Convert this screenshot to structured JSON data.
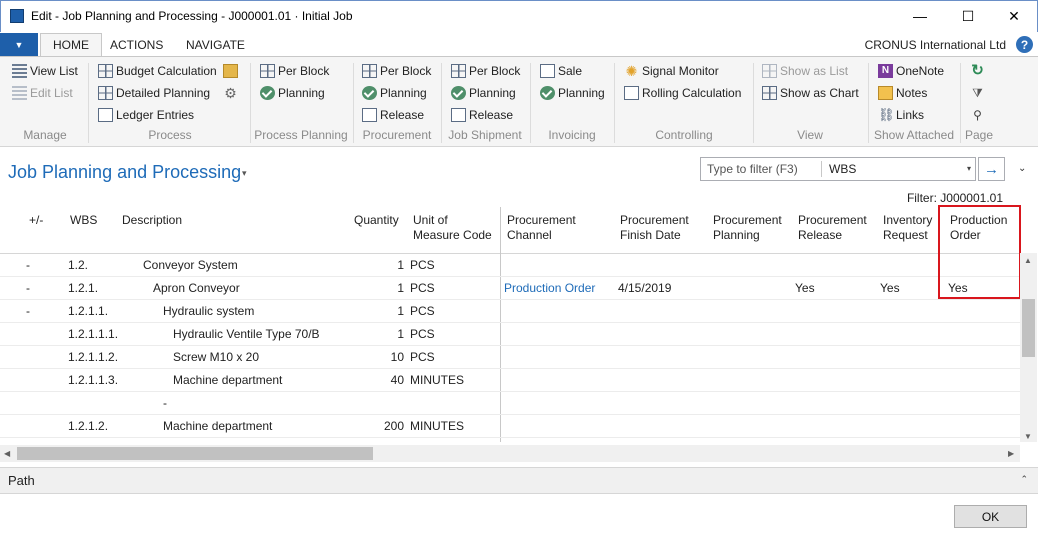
{
  "window": {
    "title": "Edit - Job Planning and Processing - J000001.01 · Initial Job",
    "controls": {
      "minimize": "—",
      "maximize": "☐",
      "close": "✕"
    }
  },
  "menu": {
    "app_menu_icon": "▼",
    "tabs": [
      "HOME",
      "ACTIONS",
      "NAVIGATE"
    ],
    "active_tab": "HOME",
    "company": "CRONUS International Ltd",
    "help": "?"
  },
  "ribbon": {
    "manage": {
      "label": "Manage",
      "view_list": "View List",
      "edit_list": "Edit List"
    },
    "process": {
      "label": "Process",
      "budget_calculation": "Budget Calculation",
      "detailed_planning": "Detailed Planning",
      "ledger_entries": "Ledger Entries"
    },
    "process_planning": {
      "label": "Process Planning",
      "per_block": "Per Block",
      "planning": "Planning"
    },
    "procurement": {
      "label": "Procurement",
      "per_block": "Per Block",
      "planning": "Planning",
      "release": "Release"
    },
    "job_shipment": {
      "label": "Job Shipment",
      "per_block": "Per Block",
      "planning": "Planning",
      "release": "Release"
    },
    "invoicing": {
      "label": "Invoicing",
      "sale": "Sale",
      "planning": "Planning"
    },
    "controlling": {
      "label": "Controlling",
      "signal_monitor": "Signal Monitor",
      "rolling_calculation": "Rolling Calculation"
    },
    "view": {
      "label": "View",
      "show_as_list": "Show as List",
      "show_as_chart": "Show as Chart"
    },
    "show_attached": {
      "label": "Show Attached",
      "onenote": "OneNote",
      "notes": "Notes",
      "links": "Links"
    },
    "page": {
      "label": "Page"
    }
  },
  "page": {
    "title": "Job Planning and Processing",
    "title_caret": "▾",
    "filter_placeholder": "Type to filter (F3)",
    "filter_field": "WBS",
    "filter_dropdown": "▾",
    "go_arrow": "→",
    "collapse": "⌄",
    "filter_line": "Filter: J000001.01"
  },
  "grid": {
    "headers": {
      "expand": "+/-",
      "wbs": "WBS",
      "description": "Description",
      "quantity": "Quantity",
      "uom_1": "Unit of",
      "uom_2": "Measure Code",
      "proc_channel_1": "Procurement",
      "proc_channel_2": "Channel",
      "proc_finish_1": "Procurement",
      "proc_finish_2": "Finish Date",
      "proc_planning_1": "Procurement",
      "proc_planning_2": "Planning",
      "proc_release_1": "Procurement",
      "proc_release_2": "Release",
      "inv_request_1": "Inventory",
      "inv_request_2": "Request",
      "prod_order_1": "Production",
      "prod_order_2": "Order"
    },
    "rows": [
      {
        "expand": "-",
        "wbs": "1.2.",
        "description": "Conveyor System",
        "indent": 0,
        "quantity": "1",
        "uom": "PCS",
        "channel": "",
        "finish": "",
        "planning": "",
        "release": "",
        "inventory": "",
        "production": ""
      },
      {
        "expand": "-",
        "wbs": "1.2.1.",
        "description": "Apron Conveyor",
        "indent": 1,
        "quantity": "1",
        "uom": "PCS",
        "channel": "Production Order",
        "finish": "4/15/2019",
        "planning": "",
        "release": "Yes",
        "inventory": "Yes",
        "production": "Yes"
      },
      {
        "expand": "-",
        "wbs": "1.2.1.1.",
        "description": "Hydraulic system",
        "indent": 2,
        "quantity": "1",
        "uom": "PCS",
        "channel": "",
        "finish": "",
        "planning": "",
        "release": "",
        "inventory": "",
        "production": ""
      },
      {
        "expand": "",
        "wbs": "1.2.1.1.1.",
        "description": "Hydraulic Ventile Type 70/B",
        "indent": 3,
        "quantity": "1",
        "uom": "PCS",
        "channel": "",
        "finish": "",
        "planning": "",
        "release": "",
        "inventory": "",
        "production": ""
      },
      {
        "expand": "",
        "wbs": "1.2.1.1.2.",
        "description": "Screw M10 x 20",
        "indent": 3,
        "quantity": "10",
        "uom": "PCS",
        "channel": "",
        "finish": "",
        "planning": "",
        "release": "",
        "inventory": "",
        "production": ""
      },
      {
        "expand": "",
        "wbs": "1.2.1.1.3.",
        "description": "Machine department",
        "indent": 3,
        "quantity": "40",
        "uom": "MINUTES",
        "channel": "",
        "finish": "",
        "planning": "",
        "release": "",
        "inventory": "",
        "production": ""
      },
      {
        "expand": "",
        "wbs": "",
        "description": "-",
        "indent": 2,
        "quantity": "",
        "uom": "",
        "channel": "",
        "finish": "",
        "planning": "",
        "release": "",
        "inventory": "",
        "production": ""
      },
      {
        "expand": "",
        "wbs": "1.2.1.2.",
        "description": "Machine department",
        "indent": 2,
        "quantity": "200",
        "uom": "MINUTES",
        "channel": "",
        "finish": "",
        "planning": "",
        "release": "",
        "inventory": "",
        "production": ""
      }
    ]
  },
  "scroll": {
    "up": "▲",
    "down": "▼",
    "left": "◀",
    "right": "▶"
  },
  "footer": {
    "path_label": "Path",
    "path_caret": "⌃",
    "ok": "OK"
  },
  "colors": {
    "accent": "#1e6bb8",
    "highlight": "#d9161d",
    "app_menu": "#1e5faa"
  }
}
